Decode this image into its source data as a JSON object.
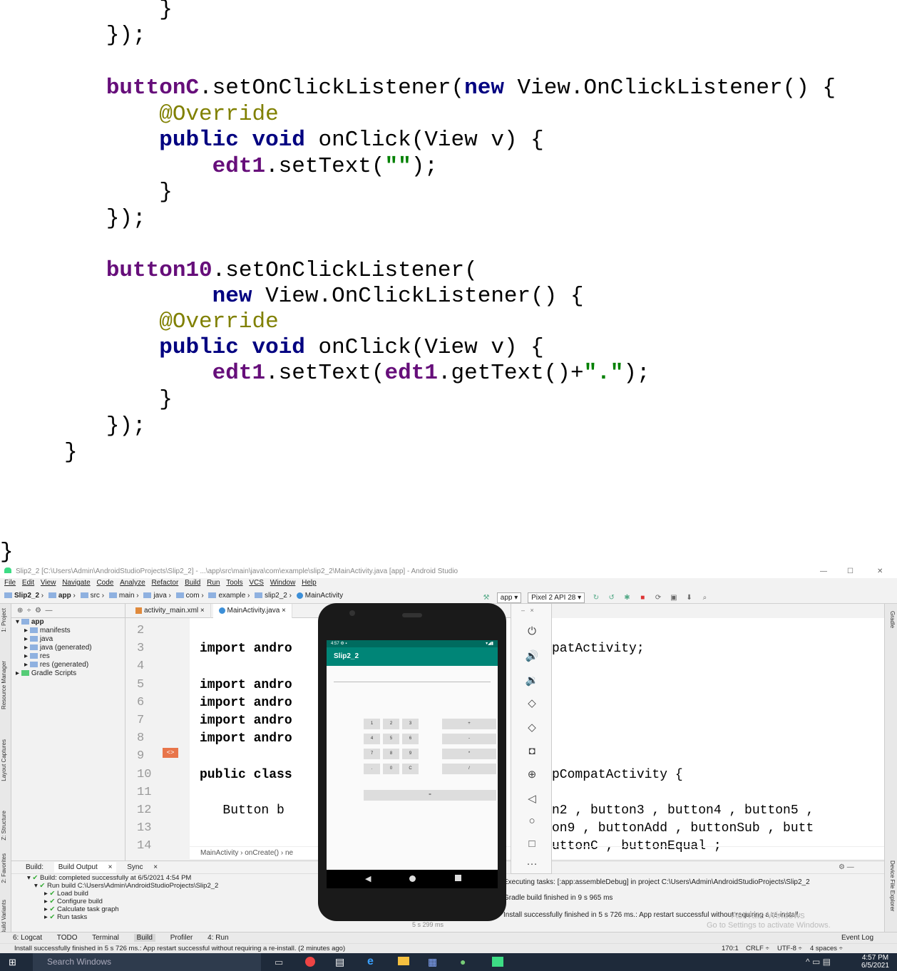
{
  "code_top": {
    "lines": [
      {
        "indent": "        ",
        "segments": [
          {
            "t": "}",
            "c": ""
          }
        ]
      },
      {
        "indent": "    ",
        "segments": [
          {
            "t": "});",
            "c": ""
          }
        ]
      },
      {
        "indent": "",
        "segments": []
      },
      {
        "indent": "    ",
        "segments": [
          {
            "t": "buttonC",
            "c": "p"
          },
          {
            "t": ".setOnClickListener(",
            "c": ""
          },
          {
            "t": "new",
            "c": "b"
          },
          {
            "t": " View.OnClickListener() {",
            "c": ""
          }
        ]
      },
      {
        "indent": "        ",
        "segments": [
          {
            "t": "@Override",
            "c": "a"
          }
        ]
      },
      {
        "indent": "        ",
        "segments": [
          {
            "t": "public",
            "c": "b"
          },
          {
            "t": " ",
            "c": ""
          },
          {
            "t": "void",
            "c": "b"
          },
          {
            "t": " onClick(View v) {",
            "c": ""
          }
        ]
      },
      {
        "indent": "            ",
        "segments": [
          {
            "t": "edt1",
            "c": "p"
          },
          {
            "t": ".setText(",
            "c": ""
          },
          {
            "t": "\"\"",
            "c": "g"
          },
          {
            "t": ");",
            "c": ""
          }
        ]
      },
      {
        "indent": "        ",
        "segments": [
          {
            "t": "}",
            "c": ""
          }
        ]
      },
      {
        "indent": "    ",
        "segments": [
          {
            "t": "});",
            "c": ""
          }
        ]
      },
      {
        "indent": "",
        "segments": []
      },
      {
        "indent": "    ",
        "segments": [
          {
            "t": "button10",
            "c": "p"
          },
          {
            "t": ".setOnClickListener(",
            "c": ""
          }
        ]
      },
      {
        "indent": "            ",
        "segments": [
          {
            "t": "new",
            "c": "b"
          },
          {
            "t": " View.OnClickListener() {",
            "c": ""
          }
        ]
      },
      {
        "indent": "        ",
        "segments": [
          {
            "t": "@Override",
            "c": "a"
          }
        ]
      },
      {
        "indent": "        ",
        "segments": [
          {
            "t": "public",
            "c": "b"
          },
          {
            "t": " ",
            "c": ""
          },
          {
            "t": "void",
            "c": "b"
          },
          {
            "t": " onClick(View v) {",
            "c": ""
          }
        ]
      },
      {
        "indent": "            ",
        "segments": [
          {
            "t": "edt1",
            "c": "p"
          },
          {
            "t": ".setText(",
            "c": ""
          },
          {
            "t": "edt1",
            "c": "p"
          },
          {
            "t": ".getText()+",
            "c": ""
          },
          {
            "t": "\".\"",
            "c": "g"
          },
          {
            "t": ");",
            "c": ""
          }
        ]
      },
      {
        "indent": "        ",
        "segments": [
          {
            "t": "}",
            "c": ""
          }
        ]
      },
      {
        "indent": "    ",
        "segments": [
          {
            "t": "});",
            "c": ""
          }
        ]
      },
      {
        "indent": "",
        "segments": [
          {
            "t": "}",
            "c": ""
          }
        ]
      }
    ],
    "closing_brace": "}"
  },
  "ide": {
    "title": "Slip2_2 [C:\\Users\\Admin\\AndroidStudioProjects\\Slip2_2] - ...\\app\\src\\main\\java\\com\\example\\slip2_2\\MainActivity.java [app] - Android Studio",
    "window_controls": [
      "—",
      "☐",
      "✕"
    ],
    "menu": [
      "File",
      "Edit",
      "View",
      "Navigate",
      "Code",
      "Analyze",
      "Refactor",
      "Build",
      "Run",
      "Tools",
      "VCS",
      "Window",
      "Help"
    ],
    "breadcrumbs": [
      "Slip2_2",
      "app",
      "src",
      "main",
      "java",
      "com",
      "example",
      "slip2_2",
      "MainActivity"
    ],
    "run_config": "app",
    "device": "Pixel 2 API 28",
    "project_tree": [
      {
        "label": "app",
        "bold": true,
        "level": 0
      },
      {
        "label": "manifests",
        "level": 1
      },
      {
        "label": "java",
        "level": 1
      },
      {
        "label": "java (generated)",
        "level": 1
      },
      {
        "label": "res",
        "level": 1
      },
      {
        "label": "res (generated)",
        "level": 1
      },
      {
        "label": "Gradle Scripts",
        "level": 0
      }
    ],
    "left_tabs": [
      "1: Project",
      "Resource Manager",
      "Layout Captures",
      "Z: Structure",
      "2: Favorites",
      "Build Variants"
    ],
    "right_tabs": [
      "Gradle",
      "Device File Explorer"
    ],
    "file_tabs": [
      "activity_main.xml",
      "MainActivity.java"
    ],
    "editor_lines": [
      {
        "num": "2",
        "text": ""
      },
      {
        "num": "3",
        "text": "import andro",
        "tail": "patActivity;"
      },
      {
        "num": "4",
        "text": ""
      },
      {
        "num": "5",
        "text": "import andro"
      },
      {
        "num": "6",
        "text": "import andro"
      },
      {
        "num": "7",
        "text": "import andro"
      },
      {
        "num": "8",
        "text": "import andro"
      },
      {
        "num": "9",
        "text": ""
      },
      {
        "num": "10",
        "text": "public class",
        "tail": "pCompatActivity {"
      },
      {
        "num": "11",
        "text": ""
      },
      {
        "num": "12",
        "text": "   Button b",
        "tail": "n2 , button3 , button4 , button5 ,"
      },
      {
        "num": "13",
        "text": "",
        "tail": "on9 , buttonAdd , buttonSub , butt"
      },
      {
        "num": "14",
        "text": "",
        "tail": "uttonC , buttonEqual ;"
      }
    ],
    "editor_breadcrumb": [
      "MainActivity",
      "onCreate()",
      "ne"
    ],
    "build": {
      "tabs": [
        "Build:",
        "Build Output",
        "Sync"
      ],
      "tree": [
        {
          "label": "Build: completed successfully at 6/5/2021 4:54 PM",
          "level": 0
        },
        {
          "label": "Run build C:\\Users\\Admin\\AndroidStudioProjects\\Slip2_2",
          "level": 1
        },
        {
          "label": "Load build",
          "level": 2
        },
        {
          "label": "Configure build",
          "level": 2
        },
        {
          "label": "Calculate task graph",
          "level": 2
        },
        {
          "label": "Run tasks",
          "level": 2
        }
      ],
      "duration": "5 s 299 ms",
      "messages": [
        "Executing tasks: [:app:assembleDebug] in project C:\\Users\\Admin\\AndroidStudioProjects\\Slip2_2",
        "Gradle build finished in 9 s 965 ms",
        "Install successfully finished in 5 s 726 ms.: App restart successful without requiring a re-install."
      ]
    },
    "tool_windows": [
      "6: Logcat",
      "TODO",
      "Terminal",
      "Build",
      "Profiler",
      "4: Run"
    ],
    "event_log": "Event Log",
    "watermark": [
      "Activate Windows",
      "Go to Settings to activate Windows."
    ],
    "status_message": "Install successfully finished in 5 s 726 ms.: App restart successful without requiring a re-install. (2 minutes ago)",
    "status_right": [
      "170:1",
      "CRLF ÷",
      "UTF-8 ÷",
      "4 spaces ÷"
    ],
    "taskbar": {
      "search": "Search Windows",
      "time": "4:57 PM",
      "date": "6/5/2021"
    }
  },
  "emulator": {
    "status_time": "4:57",
    "app_title": "Slip2_2",
    "keys": [
      "1",
      "2",
      "3",
      "4",
      "5",
      "6",
      "7",
      "8",
      "9",
      ".",
      "0",
      "C"
    ],
    "ops": [
      "+",
      "-",
      "*",
      "/"
    ],
    "equal": "="
  },
  "colors": {
    "keyword": "#000080",
    "field": "#660e7a",
    "string": "#008000",
    "annotation": "#808000",
    "app_bar": "#008577"
  }
}
